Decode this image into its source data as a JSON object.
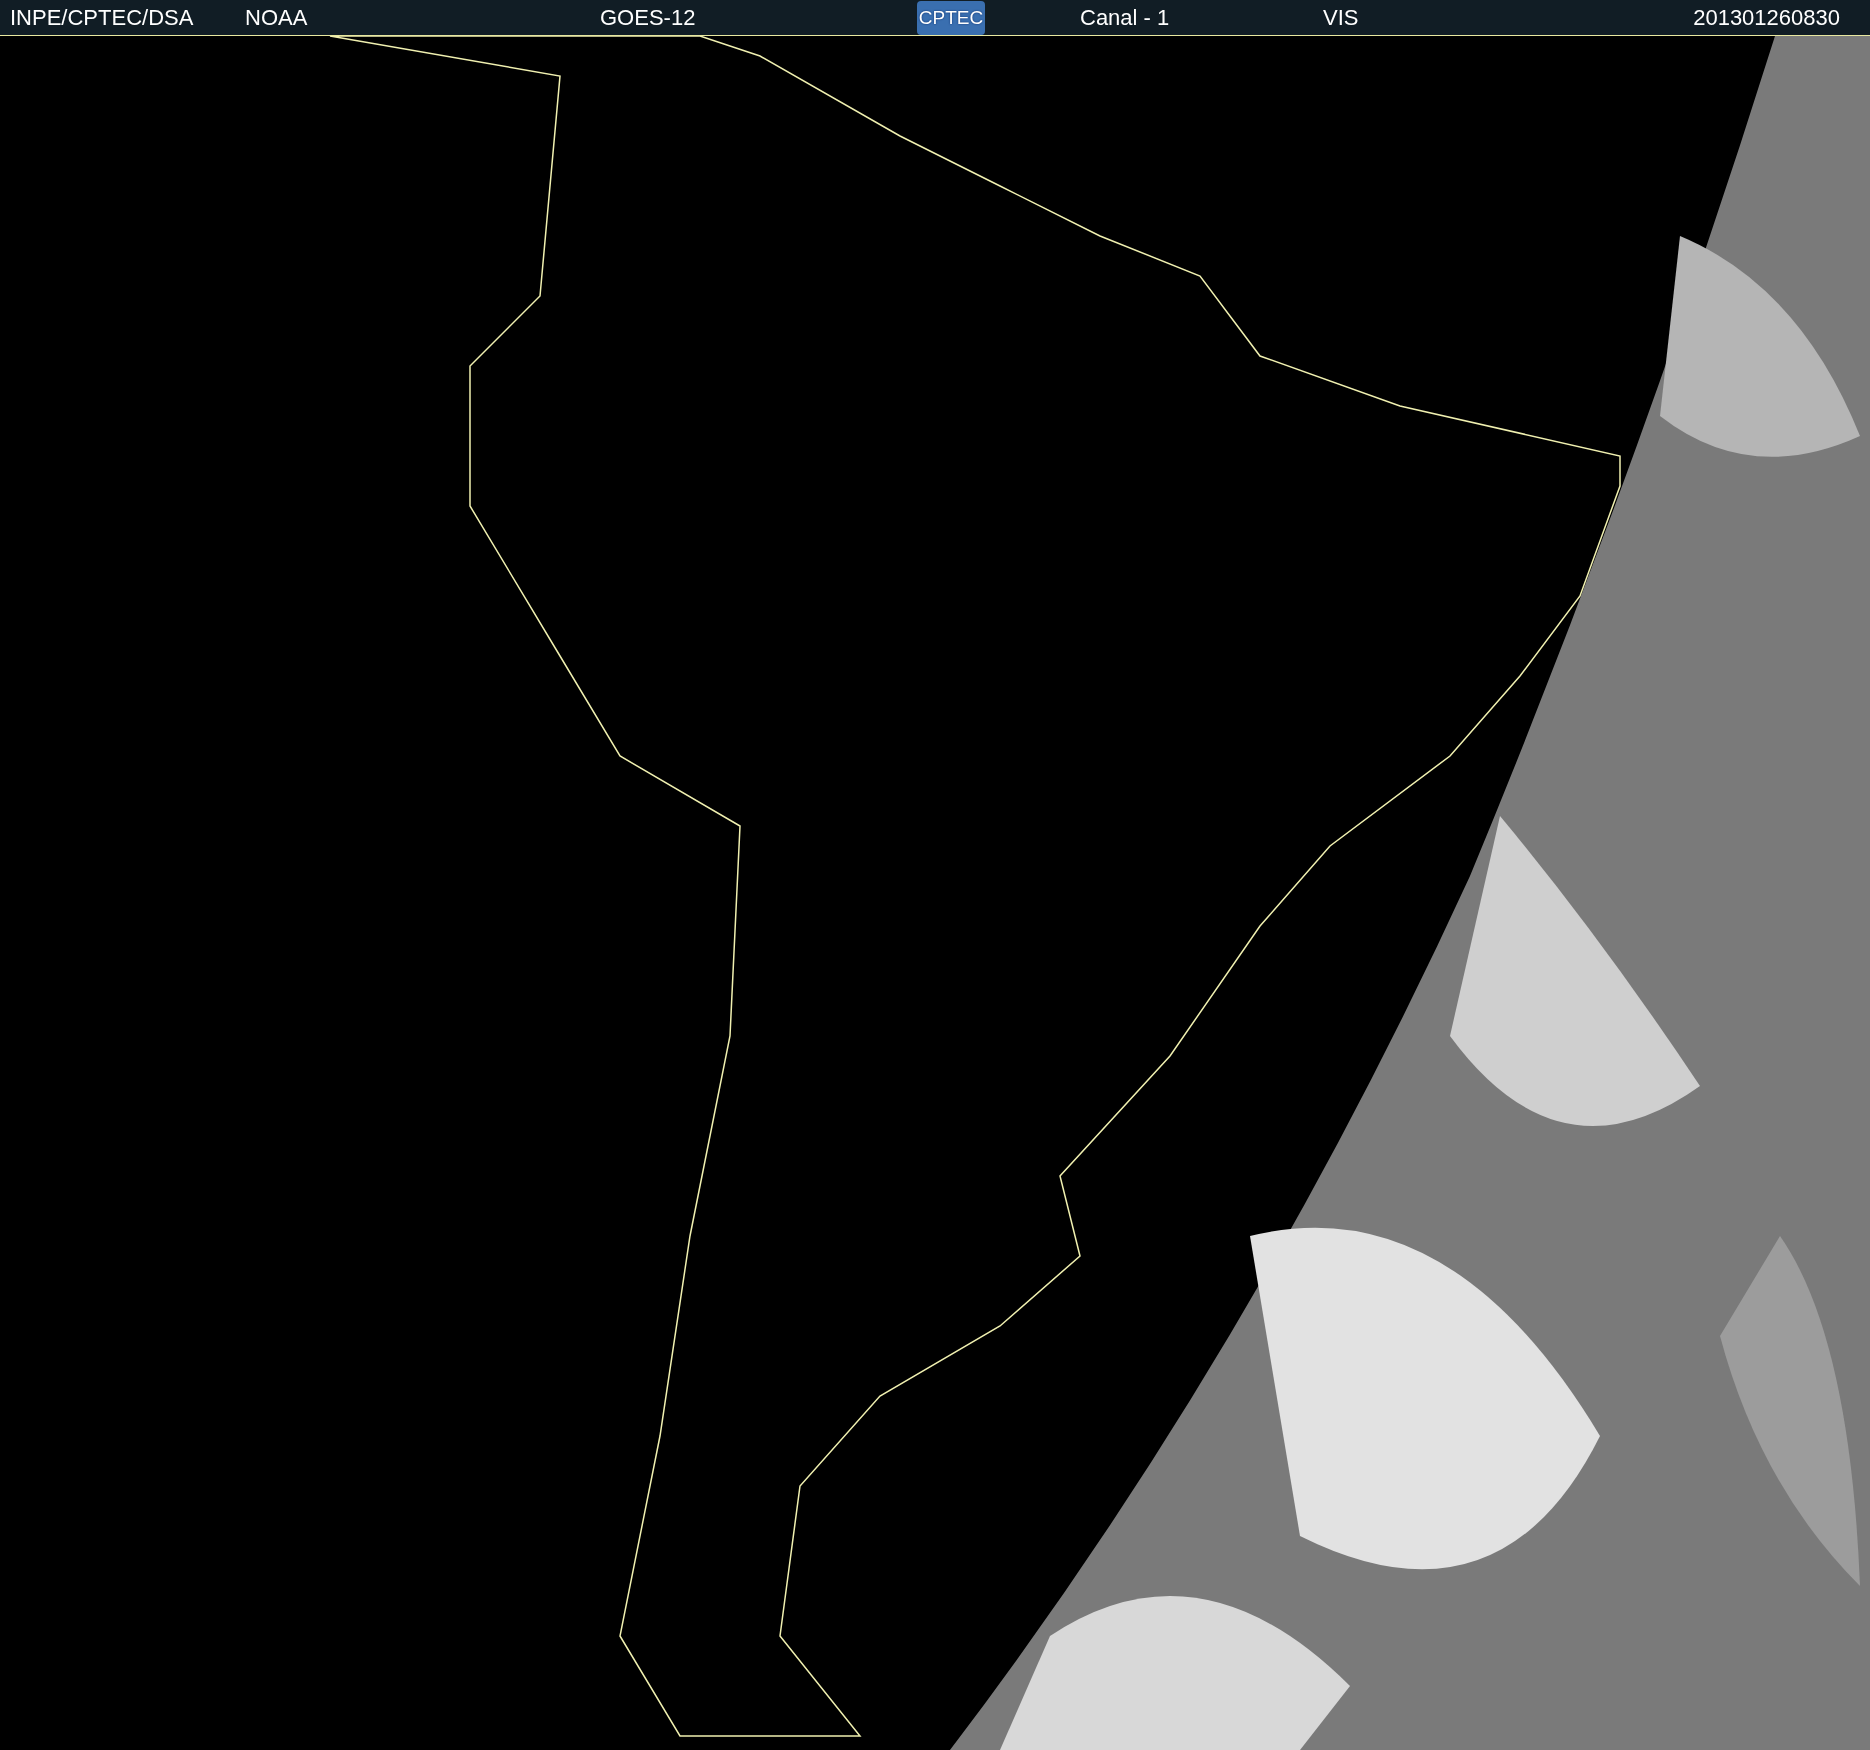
{
  "header": {
    "source": "INPE/CPTEC/DSA",
    "agency": "NOAA",
    "satellite": "GOES-12",
    "logo_text": "CPTEC",
    "channel": "Canal - 1",
    "band": "VIS",
    "timestamp": "201301260830"
  }
}
